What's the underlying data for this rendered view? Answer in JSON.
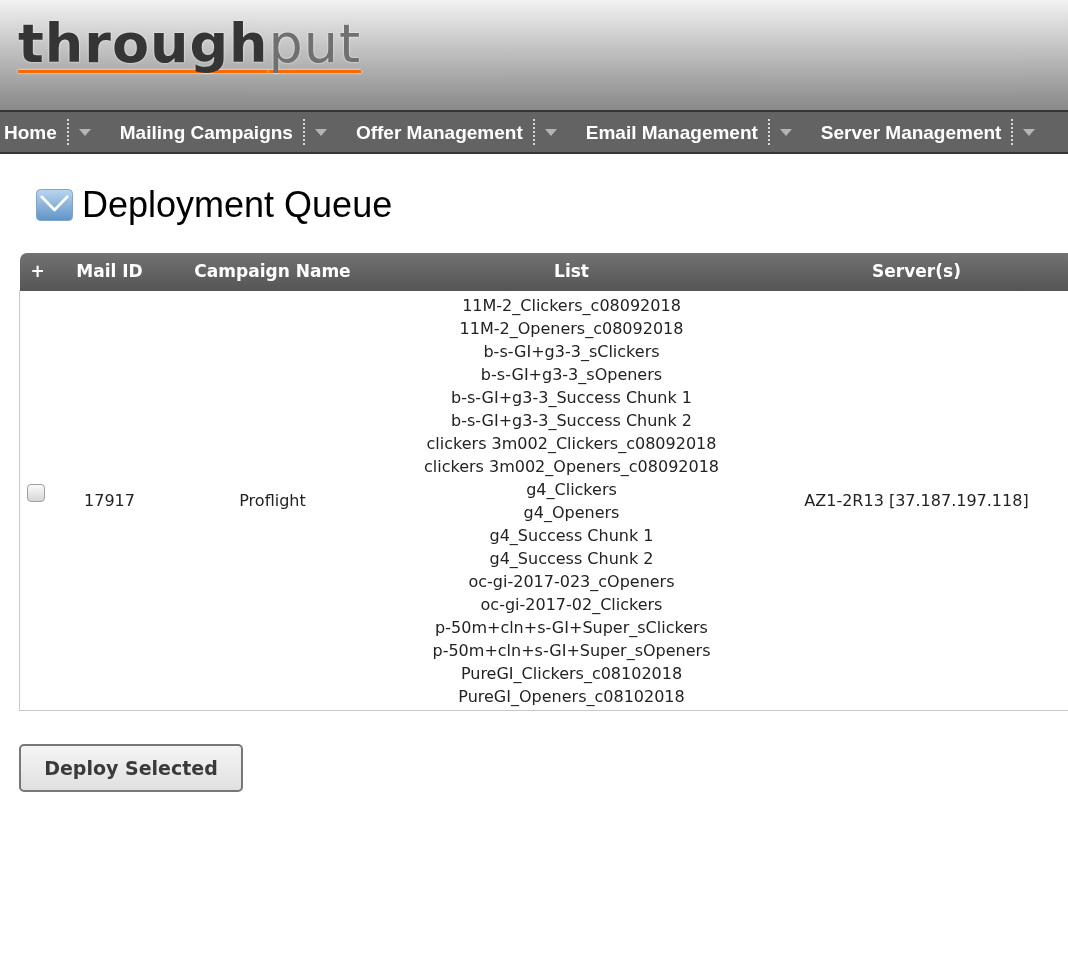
{
  "header": {
    "logo": "**through**put"
  },
  "nav": {
    "items": [
      {
        "label": "Home"
      },
      {
        "label": "Mailing Campaigns"
      },
      {
        "label": "Offer Management"
      },
      {
        "label": "Email Management"
      },
      {
        "label": "Server Management"
      }
    ]
  },
  "page": {
    "title": "Deployment Queue"
  },
  "table": {
    "columns": [
      "+",
      "Mail ID",
      "Campaign Name",
      "List",
      "Server(s)"
    ],
    "rows": [
      {
        "checked": false,
        "mail_id": "17917",
        "campaign_name": "Proflight",
        "lists": [
          "11M-2_Clickers_c08092018",
          "11M-2_Openers_c08092018",
          "b-s-GI+g3-3_sClickers",
          "b-s-GI+g3-3_sOpeners",
          "b-s-GI+g3-3_Success Chunk 1",
          "b-s-GI+g3-3_Success Chunk 2",
          "clickers 3m002_Clickers_c08092018",
          "clickers 3m002_Openers_c08092018",
          "g4_Clickers",
          "g4_Openers",
          "g4_Success Chunk 1",
          "g4_Success Chunk 2",
          "oc-gi-2017-023_cOpeners",
          "oc-gi-2017-02_Clickers",
          "p-50m+cln+s-GI+Super_sClickers",
          "p-50m+cln+s-GI+Super_sOpeners",
          "PureGI_Clickers_c08102018",
          "PureGI_Openers_c08102018"
        ],
        "servers": "AZ1-2R13 [37.187.197.118]"
      }
    ]
  },
  "buttons": [
    {
      "label": "Deploy Selected"
    }
  ]
}
